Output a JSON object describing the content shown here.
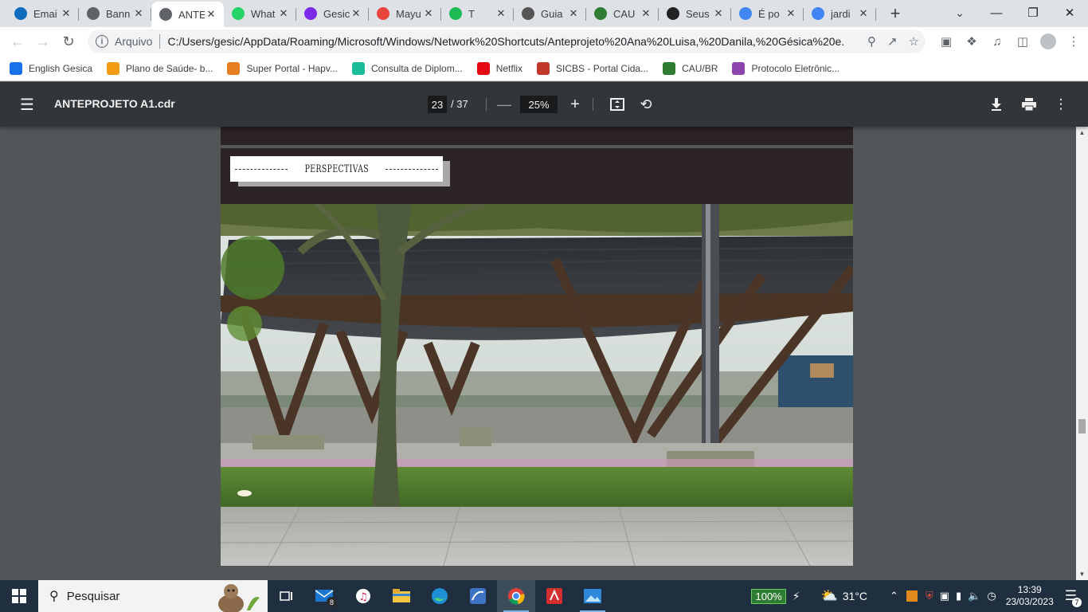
{
  "browser": {
    "tabs": [
      {
        "label": "Emai",
        "icon": "outlook-icon",
        "color": "#0f6cbd"
      },
      {
        "label": "Bann",
        "icon": "globe-icon",
        "color": "#5f6368"
      },
      {
        "label": "ANTE",
        "icon": "globe-icon",
        "color": "#5f6368",
        "active": true
      },
      {
        "label": "What",
        "icon": "whatsapp-icon",
        "color": "#25d366"
      },
      {
        "label": "Gesic",
        "icon": "canva-icon",
        "color": "#7d2ae8"
      },
      {
        "label": "Mayu",
        "icon": "target-icon",
        "color": "#e8453c"
      },
      {
        "label": "T",
        "icon": "spotify-icon",
        "color": "#1db954"
      },
      {
        "label": "Guia",
        "icon": "m-logo-icon",
        "color": "#555555"
      },
      {
        "label": "CAU",
        "icon": "cau-icon",
        "color": "#2e7d32"
      },
      {
        "label": "Seus",
        "icon": "amazon-icon",
        "color": "#222222"
      },
      {
        "label": "É po",
        "icon": "google-icon",
        "color": "#4285f4"
      },
      {
        "label": "jardi",
        "icon": "google-icon",
        "color": "#4285f4"
      }
    ],
    "address": {
      "scheme": "Arquivo",
      "url": "C:/Users/gesic/AppData/Roaming/Microsoft/Windows/Network%20Shortcuts/Anteprojeto%20Ana%20Luisa,%20Danila,%20Gésica%20e..."
    },
    "bookmarks": [
      {
        "label": "English Gesica",
        "icon": "person-icon",
        "color": "#1a73e8"
      },
      {
        "label": "Plano de Saúde- b...",
        "icon": "hapvida-icon",
        "color": "#f39c12"
      },
      {
        "label": "Super Portal - Hapv...",
        "icon": "hapvida-icon",
        "color": "#e67e22"
      },
      {
        "label": "Consulta de Diplom...",
        "icon": "diamond-icon",
        "color": "#1abc9c"
      },
      {
        "label": "Netflix",
        "icon": "netflix-icon",
        "color": "#e50914"
      },
      {
        "label": "SICBS - Portal Cida...",
        "icon": "sicbs-icon",
        "color": "#c0392b"
      },
      {
        "label": "CAU/BR",
        "icon": "cau-icon",
        "color": "#2e7d32"
      },
      {
        "label": "Protocolo Eletrônic...",
        "icon": "dots-icon",
        "color": "#8e44ad"
      }
    ]
  },
  "pdf": {
    "filename": "ANTEPROJETO A1.cdr",
    "current_page": "23",
    "total_pages": "/ 37",
    "zoom": "25%",
    "section_label": "PERSPECTIVAS"
  },
  "taskbar": {
    "search_placeholder": "Pesquisar",
    "mail_badge": "8",
    "battery": "100%",
    "temperature": "31°C",
    "time": "13:39",
    "date": "23/03/2023",
    "notification_count": "7"
  }
}
